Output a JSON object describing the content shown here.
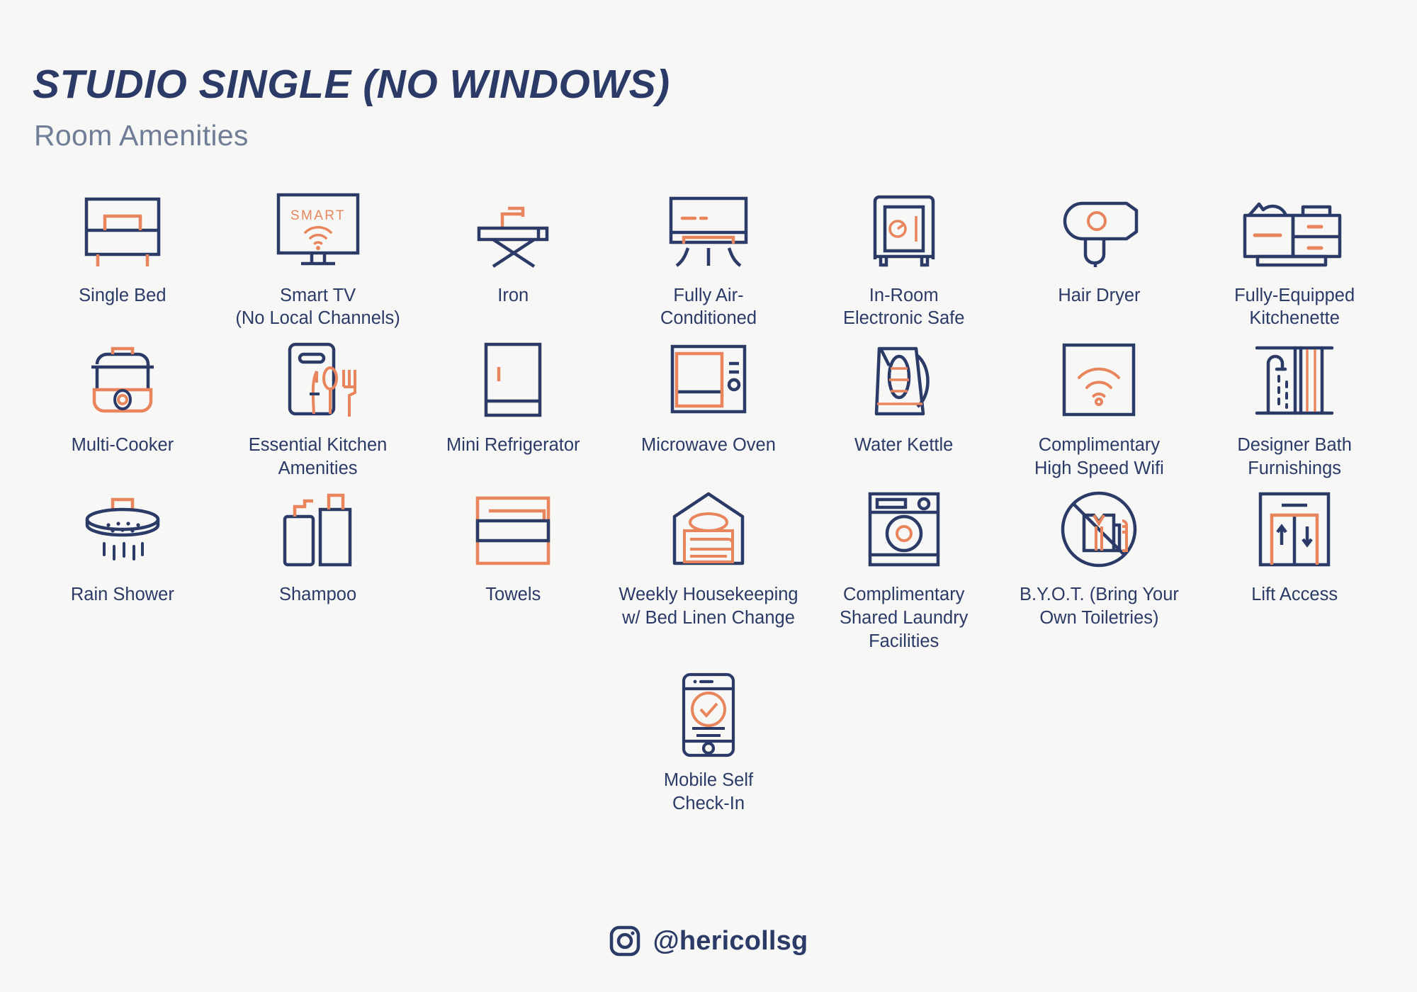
{
  "header": {
    "title": "STUDIO SINGLE (NO WINDOWS)",
    "subtitle": "Room Amenities"
  },
  "colors": {
    "navy": "#2b3a67",
    "orange": "#e8855c",
    "background": "#f7f7f5",
    "subtitle_gray": "#6f7d96"
  },
  "amenities": [
    {
      "label": "Single Bed",
      "icon": "bed-icon"
    },
    {
      "label": "Smart TV\n(No Local Channels)",
      "icon": "smart-tv-icon",
      "screen_text": "SMART"
    },
    {
      "label": "Iron",
      "icon": "iron-icon"
    },
    {
      "label": "Fully Air-\nConditioned",
      "icon": "air-conditioner-icon"
    },
    {
      "label": "In-Room\nElectronic Safe",
      "icon": "safe-icon"
    },
    {
      "label": "Hair Dryer",
      "icon": "hair-dryer-icon"
    },
    {
      "label": "Fully-Equipped\nKitchenette",
      "icon": "kitchenette-icon"
    },
    {
      "label": "Multi-Cooker",
      "icon": "multi-cooker-icon"
    },
    {
      "label": "Essential Kitchen\nAmenities",
      "icon": "cutting-board-utensils-icon"
    },
    {
      "label": "Mini Refrigerator",
      "icon": "refrigerator-icon"
    },
    {
      "label": "Microwave Oven",
      "icon": "microwave-icon"
    },
    {
      "label": "Water Kettle",
      "icon": "kettle-icon"
    },
    {
      "label": "Complimentary\nHigh Speed Wifi",
      "icon": "wifi-icon"
    },
    {
      "label": "Designer Bath\nFurnishings",
      "icon": "shower-curtain-icon"
    },
    {
      "label": "Rain Shower",
      "icon": "rain-shower-icon"
    },
    {
      "label": "Shampoo",
      "icon": "shampoo-bottles-icon"
    },
    {
      "label": "Towels",
      "icon": "towels-icon"
    },
    {
      "label": "Weekly Housekeeping\nw/ Bed Linen Change",
      "icon": "housekeeping-linen-icon"
    },
    {
      "label": "Complimentary\nShared Laundry\nFacilities",
      "icon": "washing-machine-icon"
    },
    {
      "label": "B.Y.O.T. (Bring Your\nOwn Toiletries)",
      "icon": "no-toiletries-icon"
    },
    {
      "label": "Lift Access",
      "icon": "elevator-icon"
    },
    {
      "label": "Mobile Self\nCheck-In",
      "icon": "mobile-checkin-icon"
    }
  ],
  "footer": {
    "social_icon": "instagram-icon",
    "handle": "@hericollsg"
  }
}
